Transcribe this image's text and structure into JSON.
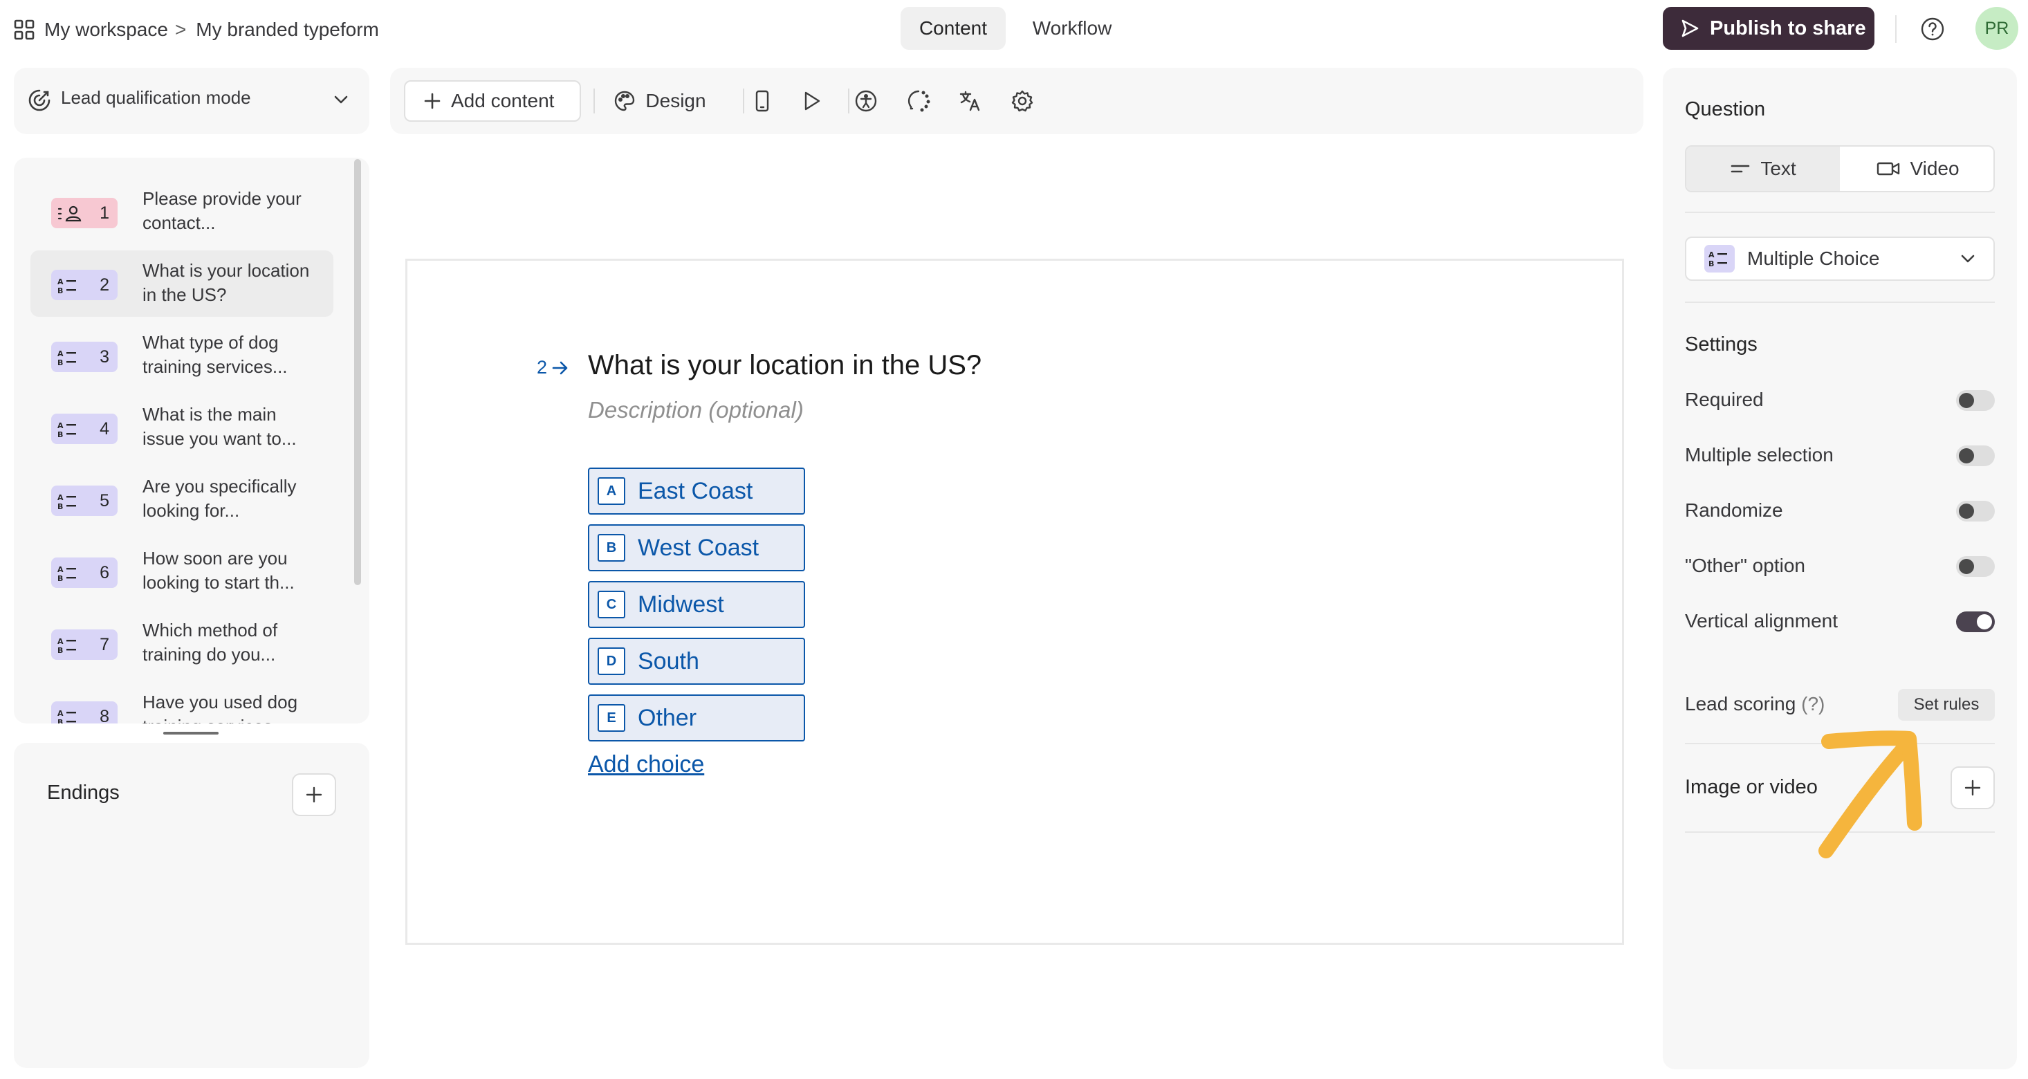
{
  "topbar": {
    "workspace": "My workspace",
    "separator": ">",
    "form_name": "My branded typeform",
    "tabs": [
      {
        "label": "Content",
        "active": true
      },
      {
        "label": "Workflow",
        "active": false
      }
    ],
    "publish_label": "Publish to share",
    "avatar_initials": "PR"
  },
  "mode": {
    "label": "Lead qualification mode"
  },
  "toolbar": {
    "add_content_label": "Add content",
    "design_label": "Design",
    "icons": [
      "mobile-preview-icon",
      "play-icon",
      "accessibility-icon",
      "loading-icon",
      "translate-icon",
      "settings-icon"
    ]
  },
  "questions": [
    {
      "num": "1",
      "type": "contact-info",
      "text": "Please provide your contact..."
    },
    {
      "num": "2",
      "type": "multiple-choice",
      "text": "What is your location in the US?",
      "active": true
    },
    {
      "num": "3",
      "type": "multiple-choice",
      "text": "What type of dog training services..."
    },
    {
      "num": "4",
      "type": "multiple-choice",
      "text": "What is the main issue you want to..."
    },
    {
      "num": "5",
      "type": "multiple-choice",
      "text": "Are you specifically looking for..."
    },
    {
      "num": "6",
      "type": "multiple-choice",
      "text": "How soon are you looking to start th..."
    },
    {
      "num": "7",
      "type": "multiple-choice",
      "text": "Which method of training do you..."
    },
    {
      "num": "8",
      "type": "multiple-choice",
      "text": "Have you used dog training services..."
    }
  ],
  "endings": {
    "title": "Endings"
  },
  "editor": {
    "question_number": "2",
    "question_title": "What is your location in the US?",
    "description_placeholder": "Description (optional)",
    "choices": [
      {
        "key": "A",
        "label": "East Coast"
      },
      {
        "key": "B",
        "label": "West Coast"
      },
      {
        "key": "C",
        "label": "Midwest"
      },
      {
        "key": "D",
        "label": "South"
      },
      {
        "key": "E",
        "label": "Other"
      }
    ],
    "add_choice_label": "Add choice"
  },
  "right_panel": {
    "question_heading": "Question",
    "format_options": [
      {
        "label": "Text",
        "active": true
      },
      {
        "label": "Video",
        "active": false
      }
    ],
    "question_type": "Multiple Choice",
    "settings_heading": "Settings",
    "settings": [
      {
        "label": "Required",
        "on": false
      },
      {
        "label": "Multiple selection",
        "on": false
      },
      {
        "label": "Randomize",
        "on": false
      },
      {
        "label": "\"Other\" option",
        "on": false
      },
      {
        "label": "Vertical alignment",
        "on": true
      }
    ],
    "lead_scoring_label": "Lead scoring",
    "lead_scoring_hint": "(?)",
    "set_rules_label": "Set rules",
    "image_video_label": "Image or video"
  },
  "colors": {
    "accent": "#0b57a9",
    "publish_bg": "#3d2b3a",
    "annotation_arrow": "#f5b53d",
    "contact_badge": "#f7c8d2",
    "choice_badge": "#d9d5f7"
  }
}
